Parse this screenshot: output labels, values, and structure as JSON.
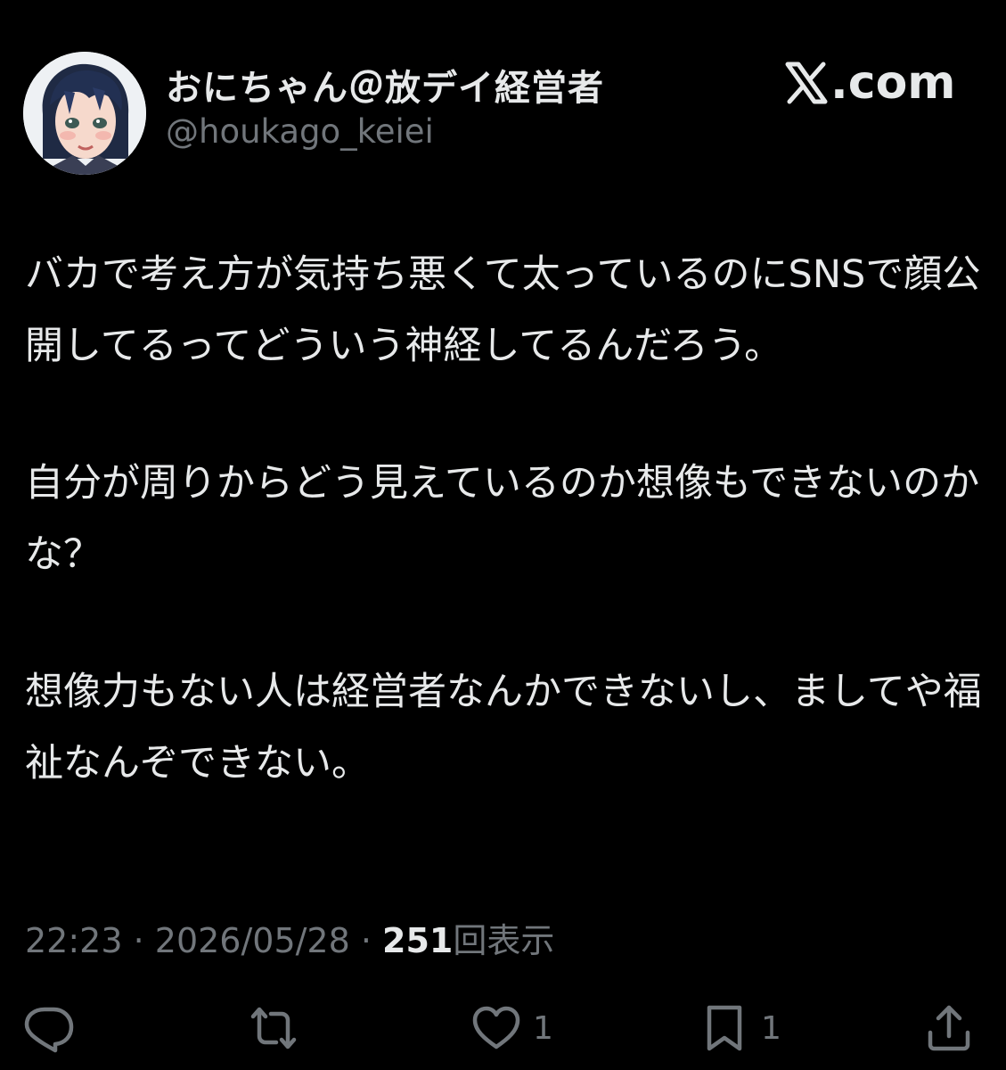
{
  "header": {
    "display_name": "おにちゃん＠放デイ経営者",
    "handle": "@houkago_keiei",
    "brand_text": ".com"
  },
  "post": {
    "paragraphs": [
      "バカで考え方が気持ち悪くて太っているのにSNSで顔公開してるってどういう神経してるんだろう。",
      "自分が周りからどう見えているのか想像もできないのかな？",
      "想像力もない人は経営者なんかできないし、ましてや福祉なんぞできない。"
    ]
  },
  "meta": {
    "time": "22:23",
    "separator": " · ",
    "date": "2026/05/28",
    "separator2": " · ",
    "views_count": "251",
    "views_label": "回表示"
  },
  "actions": {
    "reply_icon": "reply-icon",
    "repost_icon": "repost-icon",
    "like_icon": "heart-icon",
    "like_count": "1",
    "bookmark_icon": "bookmark-icon",
    "bookmark_count": "1",
    "share_icon": "share-icon"
  },
  "colors": {
    "background": "#000000",
    "primary_text": "#e7e9ea",
    "secondary_text": "#71767b"
  }
}
